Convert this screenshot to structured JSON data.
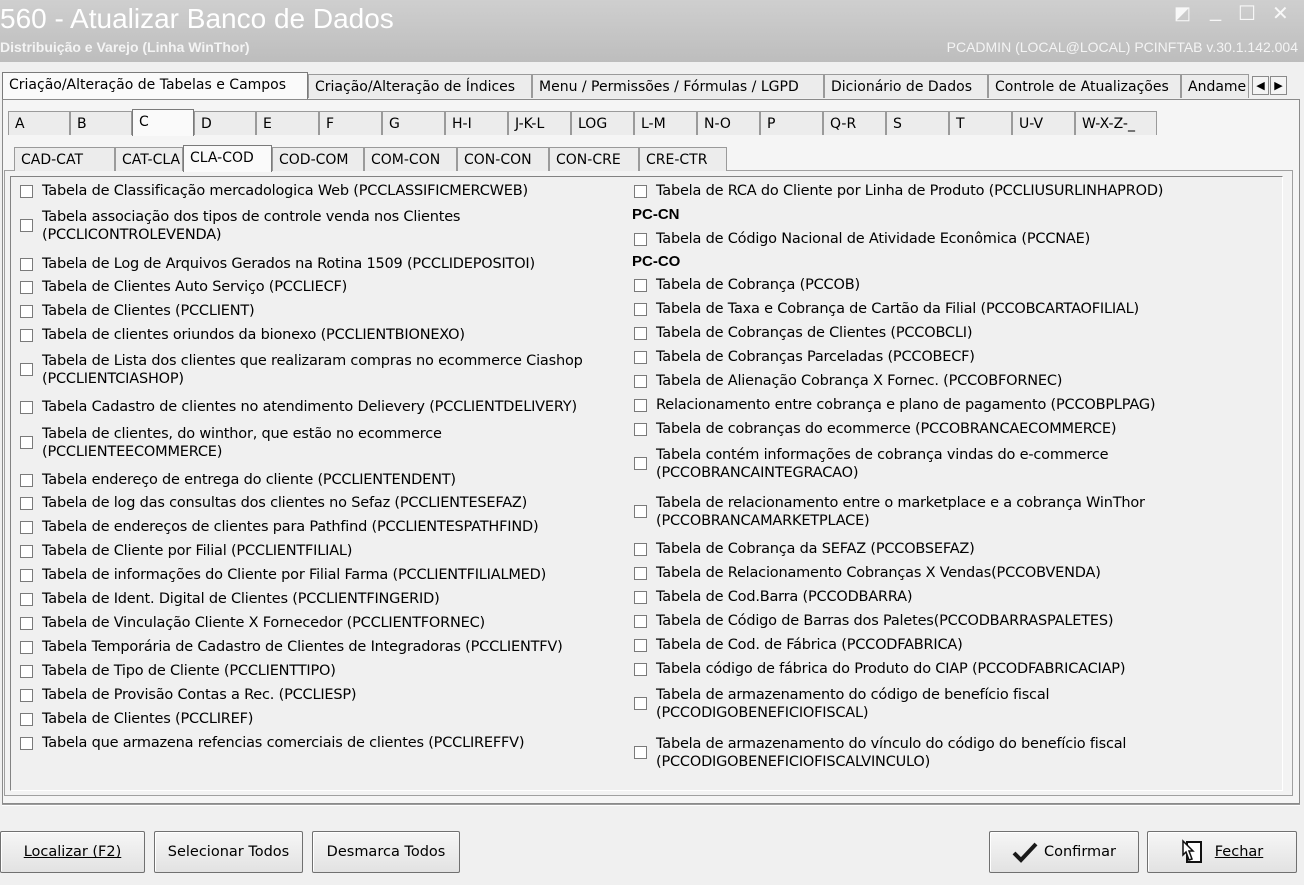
{
  "window": {
    "title": "560 - Atualizar Banco de Dados",
    "subtitle": "Distribuição e Varejo (Linha WinThor)",
    "info": "PCADMIN (LOCAL@LOCAL)   PCINFTAB  v.30.1.142.004",
    "controls": [
      "◩",
      "_",
      "☐",
      "✕"
    ]
  },
  "main_tabs": [
    "Criação/Alteração de Tabelas e Campos",
    "Criação/Alteração de Índices",
    "Menu / Permissões / Fórmulas / LGPD",
    "Dicionário de Dados",
    "Controle de Atualizações",
    "Andame"
  ],
  "main_tab_scroll": [
    "◀",
    "▶"
  ],
  "letter_tabs": [
    "A",
    "B",
    "C",
    "D",
    "E",
    "F",
    "G",
    "H-I",
    "J-K-L",
    "LOG",
    "L-M",
    "N-O",
    "P",
    "Q-R",
    "S",
    "T",
    "U-V",
    "W-X-Z-_"
  ],
  "sub_tabs": [
    "CAD-CAT",
    "CAT-CLA",
    "CLA-COD",
    "COD-COM",
    "COM-CON",
    "CON-CON",
    "CON-CRE",
    "CRE-CTR"
  ],
  "left_items": [
    "Tabela de Classificação mercadologica Web (PCCLASSIFICMERCWEB)",
    "Tabela associação dos tipos de controle venda nos Clientes\n(PCCLICONTROLEVENDA)",
    "Tabela de Log de Arquivos Gerados na Rotina 1509 (PCCLIDEPOSITOI)",
    "Tabela  de Clientes Auto Serviço (PCCLIECF)",
    "Tabela de Clientes (PCCLIENT)",
    "Tabela de clientes oriundos da bionexo (PCCLIENTBIONEXO)",
    "Tabela de Lista dos clientes que realizaram compras no ecommerce Ciashop\n(PCCLIENTCIASHOP)",
    "Tabela Cadastro de clientes no atendimento Delievery (PCCLIENTDELIVERY)",
    "Tabela de clientes, do winthor, que estão no ecommerce\n(PCCLIENTEECOMMERCE)",
    "Tabela endereço de entrega do cliente (PCCLIENTENDENT)",
    "Tabela de log das consultas dos clientes no Sefaz (PCCLIENTESEFAZ)",
    "Tabela de endereços de clientes para Pathfind (PCCLIENTESPATHFIND)",
    "Tabela de Cliente por Filial (PCCLIENTFILIAL)",
    "Tabela de informações do Cliente por Filial Farma (PCCLIENTFILIALMED)",
    "Tabela de Ident. Digital de Clientes (PCCLIENTFINGERID)",
    "Tabela de Vinculação Cliente X Fornecedor (PCCLIENTFORNEC)",
    "Tabela Temporária de Cadastro de Clientes de Integradoras (PCCLIENTFV)",
    "Tabela de Tipo de Cliente (PCCLIENTTIPO)",
    "Tabela de Provisão Contas a Rec. (PCCLIESP)",
    "Tabela de Clientes (PCCLIREF)",
    "Tabela que armazena refencias comerciais de clientes (PCCLIREFFV)"
  ],
  "right_item_top": "Tabela de RCA do Cliente por Linha de Produto (PCCLIUSURLINHAPROD)",
  "section_cn": "PC-CN",
  "right_items_cn": [
    "Tabela de Código Nacional de Atividade Econômica (PCCNAE)"
  ],
  "section_co": "PC-CO",
  "right_items_co": [
    "Tabela de Cobrança (PCCOB)",
    "Tabela de Taxa e Cobrança de Cartão da Filial (PCCOBCARTAOFILIAL)",
    "Tabela de Cobranças de Clientes (PCCOBCLI)",
    "Tabela de Cobranças Parceladas (PCCOBECF)",
    "Tabela de Alienação Cobrança X Fornec. (PCCOBFORNEC)",
    "Relacionamento entre cobrança e plano de pagamento (PCCOBPLPAG)",
    "Tabela de cobranças do ecommerce (PCCOBRANCAECOMMERCE)",
    "Tabela contém informações de cobrança vindas do e-commerce\n(PCCOBRANCAINTEGRACAO)",
    "Tabela de relacionamento entre o marketplace e a cobrança WinThor\n(PCCOBRANCAMARKETPLACE)",
    "Tabela de Cobrança da SEFAZ (PCCOBSEFAZ)",
    "Tabela de Relacionamento Cobranças X Vendas(PCCOBVENDA)",
    "Tabela de Cod.Barra (PCCODBARRA)",
    "Tabela de Código de Barras dos Paletes(PCCODBARRASPALETES)",
    "Tabela de Cod. de Fábrica (PCCODFABRICA)",
    "Tabela código de fábrica do Produto do CIAP (PCCODFABRICACIAP)",
    "Tabela de armazenamento do código de benefício fiscal\n(PCCODIGOBENEFICIOFISCAL)",
    "Tabela de armazenamento do vínculo do código do benefício fiscal\n(PCCODIGOBENEFICIOFISCALVINCULO)"
  ],
  "buttons": {
    "localizar": "Localizar (F2)",
    "selecionar": "Selecionar Todos",
    "desmarca": "Desmarca Todos",
    "confirmar": "Confirmar",
    "fechar": "Fechar"
  }
}
